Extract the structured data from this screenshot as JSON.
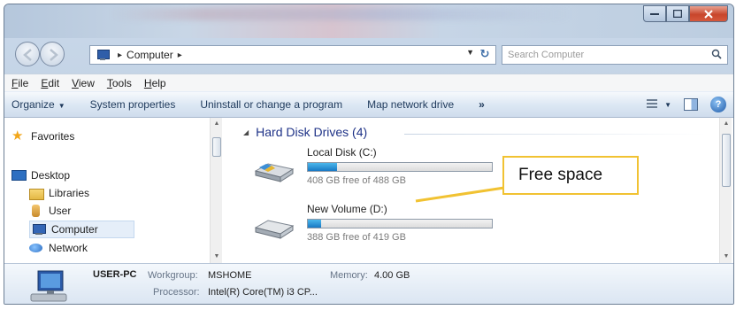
{
  "window": {
    "caption_buttons": [
      "minimize",
      "maximize",
      "close"
    ]
  },
  "nav": {
    "address": {
      "root_icon": "computer-icon",
      "location": "Computer"
    },
    "search": {
      "placeholder": "Search Computer"
    }
  },
  "menu": {
    "items": [
      {
        "accel": "F",
        "rest": "ile"
      },
      {
        "accel": "E",
        "rest": "dit"
      },
      {
        "accel": "V",
        "rest": "iew"
      },
      {
        "accel": "T",
        "rest": "ools"
      },
      {
        "accel": "H",
        "rest": "elp"
      }
    ]
  },
  "toolbar": {
    "organize": "Organize",
    "system_properties": "System properties",
    "uninstall": "Uninstall or change a program",
    "map_drive": "Map network drive",
    "more": "»",
    "help": "?"
  },
  "sidebar": {
    "items": [
      {
        "label": "Favorites",
        "icon": "star-icon"
      },
      {
        "label": "Desktop",
        "icon": "desktop-icon"
      },
      {
        "label": "Libraries",
        "icon": "libraries-icon"
      },
      {
        "label": "User",
        "icon": "user-icon"
      },
      {
        "label": "Computer",
        "icon": "computer-icon"
      },
      {
        "label": "Network",
        "icon": "network-icon"
      }
    ]
  },
  "main": {
    "group_title": "Hard Disk Drives (4)",
    "drives": [
      {
        "name": "Local Disk (C:)",
        "free_text": "408 GB free of 488 GB",
        "used_fraction": 0.16
      },
      {
        "name": "New Volume (D:)",
        "free_text": "388 GB free of 419 GB",
        "used_fraction": 0.07
      }
    ]
  },
  "details": {
    "pc_name": "USER-PC",
    "workgroup_label": "Workgroup:",
    "workgroup_value": "MSHOME",
    "memory_label": "Memory:",
    "memory_value": "4.00 GB",
    "processor_label": "Processor:",
    "processor_value": "Intel(R) Core(TM) i3 CP..."
  },
  "annotation": {
    "callout_text": "Free space",
    "callout_color": "#f1c232"
  }
}
